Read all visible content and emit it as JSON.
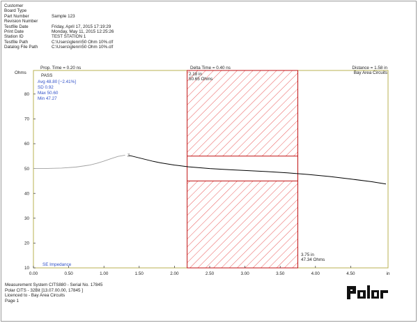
{
  "report": {
    "fields": [
      {
        "label": "Customer",
        "value": ""
      },
      {
        "label": "Board Type",
        "value": ""
      },
      {
        "label": "Part Number",
        "value": "Sample 123"
      },
      {
        "label": "Revision Number",
        "value": ""
      },
      {
        "label": "Testfile Date",
        "value": "Friday, April 17, 2015 17:19:29"
      },
      {
        "label": "Print Date",
        "value": "Monday, May 11, 2015 12:25:26"
      },
      {
        "label": "Station ID",
        "value": "TEST STATION 1"
      },
      {
        "label": "Testfile Path",
        "value": "C:\\Users\\glenn\\50 Ohm 10%.clf"
      },
      {
        "label": "Datalog File Path",
        "value": "C:\\Users\\glenn\\50 Ohm 10%.clf"
      }
    ]
  },
  "chart_header": {
    "prop_time": "Prop. Time = 0.20 ns",
    "delta_time": "Delta Time = 0.40 ns",
    "distance": "Distance = 1.58 in",
    "company": "Bay Area Circuits"
  },
  "stats": {
    "result": "PASS",
    "avg": "Avg 48.80  [−2.41%]",
    "sd": "SD   0.92",
    "max": "Max 50.60",
    "min": "Min  47.27"
  },
  "cursors": {
    "left_label_1": "2.18 in",
    "left_label_2": "50.65 Ohms",
    "right_label_1": "3.75 in",
    "right_label_2": "47.34 Ohms",
    "left_x": 2.18,
    "right_x": 3.75,
    "band_lower_y": 45,
    "band_upper_y": 55
  },
  "chart_data": {
    "type": "line",
    "ylabel": "Ohms",
    "xlabel_unit": "in",
    "legend_label": "SE Impedance",
    "ylim": [
      10,
      90
    ],
    "xlim": [
      0,
      5.2
    ],
    "y_ticks": [
      10,
      20,
      30,
      40,
      50,
      60,
      70,
      80
    ],
    "x_ticks": [
      0.0,
      0.5,
      1.0,
      1.5,
      2.0,
      2.5,
      3.0,
      3.5,
      4.0,
      4.5
    ],
    "y_tick_labels": [
      "10",
      "20",
      "30",
      "40",
      "50",
      "60",
      "70",
      "80"
    ],
    "x_tick_labels": [
      "0.00",
      "0.50",
      "1.00",
      "1.50",
      "2.00",
      "2.50",
      "3.00",
      "3.50",
      "4.00",
      "4.50",
      "in"
    ],
    "series": [
      {
        "color": "#000000",
        "x": [
          0.0,
          0.2,
          0.4,
          0.6,
          0.8,
          0.9,
          1.0,
          1.1,
          1.2,
          1.3,
          1.35,
          1.4,
          1.5,
          1.6,
          1.7,
          1.8,
          2.0,
          2.2,
          2.5,
          2.8,
          3.0,
          3.3,
          3.6,
          3.9,
          4.2,
          4.5,
          4.8,
          5.0
        ],
        "y": [
          50.0,
          50.05,
          50.2,
          50.6,
          51.4,
          52.1,
          53.0,
          54.0,
          54.9,
          55.4,
          55.3,
          55.0,
          54.3,
          53.6,
          52.9,
          52.3,
          51.4,
          50.7,
          50.0,
          49.5,
          49.2,
          48.8,
          48.3,
          47.6,
          46.8,
          45.8,
          44.7,
          43.8
        ],
        "highlight_x_range": [
          1.34,
          5.0
        ]
      }
    ],
    "annotations": [
      {
        "text": "Z",
        "x": 1.34,
        "y": 55.3
      }
    ]
  },
  "footer": {
    "line1": "Measurement System CITS880 - Serial No. 17845",
    "line2": "Polar CITS - 32Bit [13.07.00.00,  17845 ]",
    "line3": "Licenced to - Bay Area Circuits",
    "line4": "Page 1"
  },
  "logo": {
    "text": "Polar"
  }
}
